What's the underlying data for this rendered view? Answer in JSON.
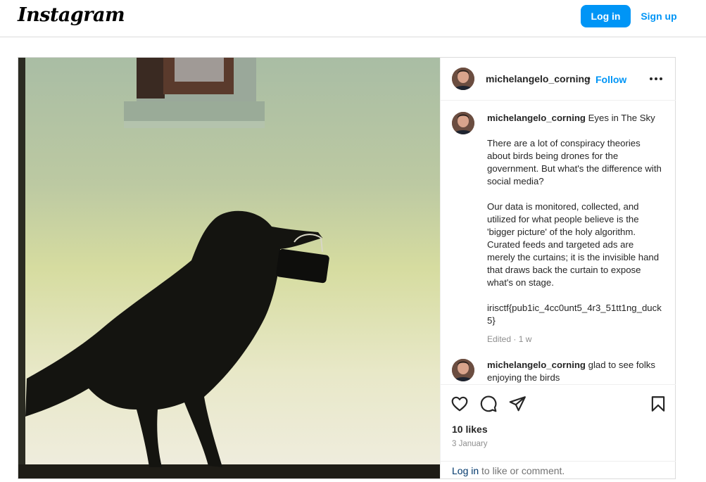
{
  "nav": {
    "logo": "Instagram",
    "login_label": "Log in",
    "signup_label": "Sign up"
  },
  "post": {
    "username": "michelangelo_corning",
    "separator": "•",
    "follow_label": "Follow",
    "more_icon": "more-options-icon",
    "caption": {
      "username": "michelangelo_corning",
      "title": "Eyes in The Sky",
      "paragraph1": "There are a lot of conspiracy theories about birds being drones for the government. But what's the difference with social media?",
      "paragraph2": "Our data is monitored, collected, and utilized for what people believe is the 'bigger picture' of the holy algorithm. Curated feeds and targeted ads are merely the curtains; it is the invisible hand that draws back the curtain to expose what's on stage.",
      "paragraph3": "irisctf{pub1ic_4cc0unt5_4r3_51tt1ng_duck5}",
      "meta": "Edited · 1 w"
    },
    "comment": {
      "username": "michelangelo_corning",
      "text": "glad to see folks enjoying the birds"
    },
    "actions": {
      "icons": [
        "heart-icon",
        "comment-icon",
        "share-icon",
        "bookmark-icon"
      ]
    },
    "likes": "10 likes",
    "date": "3 January",
    "login_prompt": {
      "link": "Log in",
      "rest": " to like or comment."
    }
  },
  "colors": {
    "accent": "#0095f6",
    "border": "#dbdbdb",
    "muted": "#8e8e8e"
  }
}
